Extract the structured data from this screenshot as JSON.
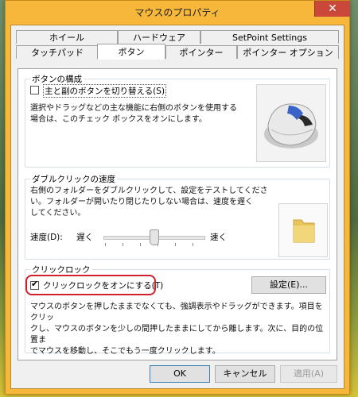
{
  "window": {
    "title": "マウスのプロパティ",
    "close_label": "✕"
  },
  "tabs_row1": [
    "ホイール",
    "ハードウェア",
    "SetPoint Settings"
  ],
  "tabs_row2": [
    "タッチパッド",
    "ボタン",
    "ポインター",
    "ポインター オプション"
  ],
  "active_tab": "ボタン",
  "button_config": {
    "group_title": "ボタンの構成",
    "checkbox_label": "主と副のボタンを切り替える(S)",
    "checked": false,
    "description": [
      "選択やドラッグなどの主な機能に右側のボタンを使用する",
      "場合は、このチェック ボックスをオンにします。"
    ]
  },
  "double_click": {
    "group_title": "ダブルクリックの速度",
    "description": [
      "右側のフォルダーをダブルクリックして、設定をテストしてくださ",
      "い。フォルダーが開いたり閉じたりしない場合は、速度を遅く",
      "してください。"
    ],
    "speed_label": "速度(D):",
    "slow_label": "遅く",
    "fast_label": "速く"
  },
  "click_lock": {
    "group_title": "クリックロック",
    "checkbox_label": "クリックロックをオンにする(T)",
    "checked": true,
    "settings_button": "設定(E)...",
    "description": [
      "マウスのボタンを押したままでなくても、強調表示やドラッグができます。項目をクリッ",
      "クし、マウスのボタンを少しの間押したままにしてから離します。次に、目的の位置ま",
      "でマウスを移動し、そこでもう一度クリックします。"
    ]
  },
  "footer": {
    "ok": "OK",
    "cancel": "キャンセル",
    "apply": "適用(A)"
  },
  "colors": {
    "title_bar": "#f7b73a",
    "highlight_ring": "#d0202a",
    "close_button": "#c9483a"
  }
}
